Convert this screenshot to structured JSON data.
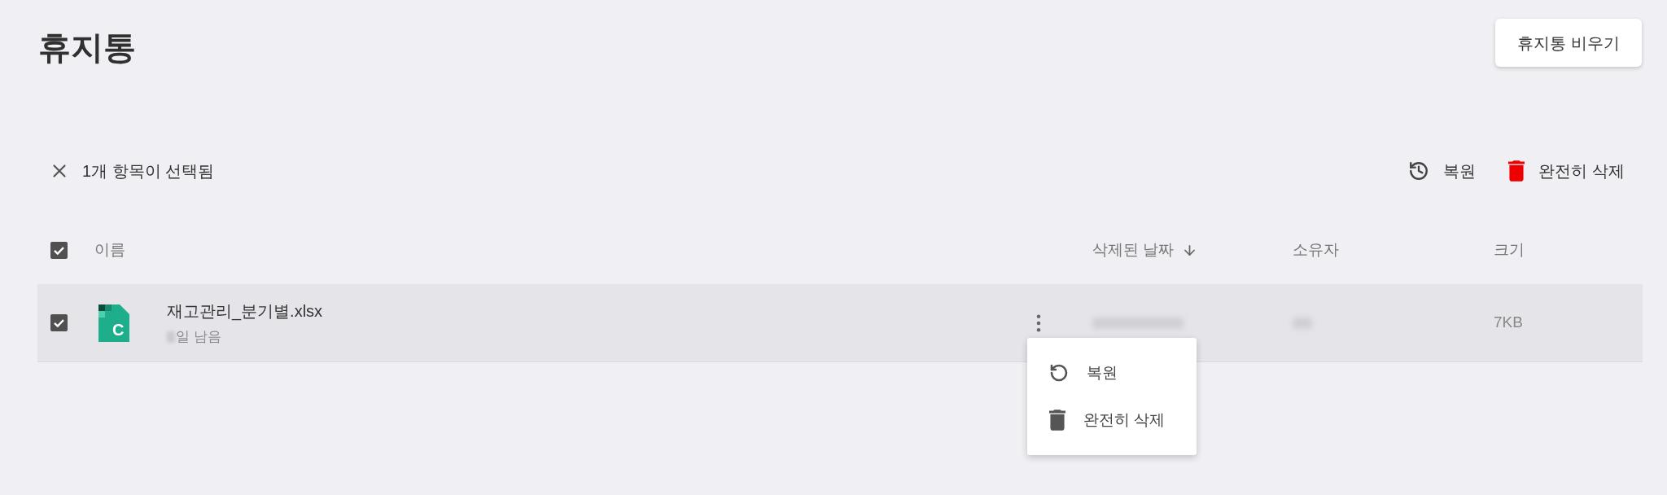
{
  "page": {
    "title": "휴지통",
    "empty_button": "휴지통 비우기"
  },
  "selection_bar": {
    "count_label": "1개 항목이 선택됨",
    "actions": [
      {
        "kind": "restore",
        "label": "복원"
      },
      {
        "kind": "delete",
        "label": "완전히 삭제"
      }
    ]
  },
  "table": {
    "select_all_checked": true,
    "columns": [
      {
        "label": "이름",
        "sorted": false
      },
      {
        "label": "삭제된 날짜",
        "sorted": true
      },
      {
        "label": "소유자",
        "sorted": false
      },
      {
        "label": "크기",
        "sorted": false
      }
    ],
    "rows": [
      {
        "icon_letter": "C",
        "name": "재고관리_분기별.xlsx",
        "remaining": "일 남음",
        "size": "7KB",
        "selected": true,
        "menu_open": true,
        "menu": [
          {
            "kind": "restore",
            "label": "복원"
          },
          {
            "kind": "delete",
            "label": "완전히 삭제"
          }
        ]
      }
    ]
  }
}
